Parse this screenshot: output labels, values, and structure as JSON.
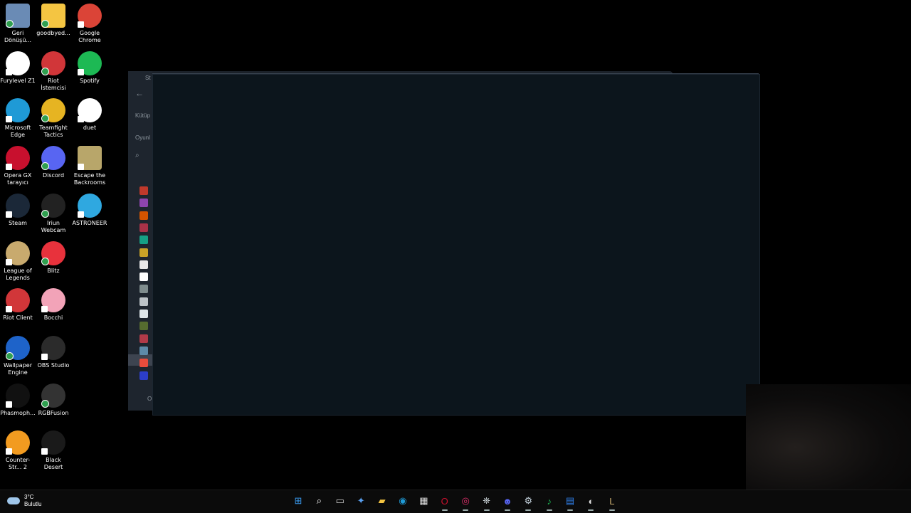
{
  "desktop_icons": [
    {
      "label": "Geri Dönüşü...",
      "icon": "recycle-bin-icon",
      "color": "#6a8bb5"
    },
    {
      "label": "goodbyed...",
      "icon": "folder-icon",
      "color": "#f4c542"
    },
    {
      "label": "Google Chrome",
      "icon": "chrome-icon",
      "color": "#db4437"
    },
    {
      "label": "Furylevel Z1",
      "icon": "furylevel-icon",
      "color": "#ffffff"
    },
    {
      "label": "Riot İstemcisi",
      "icon": "riot-client-icon",
      "color": "#d13639"
    },
    {
      "label": "Spotify",
      "icon": "spotify-icon",
      "color": "#1db954"
    },
    {
      "label": "Microsoft Edge",
      "icon": "edge-icon",
      "color": "#1f9ad6"
    },
    {
      "label": "Teamfight Tactics",
      "icon": "tft-icon",
      "color": "#e6b422"
    },
    {
      "label": "duet",
      "icon": "duet-icon",
      "color": "#ffffff"
    },
    {
      "label": "Opera GX tarayıcı",
      "icon": "opera-gx-icon",
      "color": "#c8102e"
    },
    {
      "label": "Discord",
      "icon": "discord-icon",
      "color": "#5865f2"
    },
    {
      "label": "Escape the Backrooms",
      "icon": "escape-backrooms-icon",
      "color": "#b8a66a"
    },
    {
      "label": "Steam",
      "icon": "steam-icon",
      "color": "#1b2838"
    },
    {
      "label": "Iriun Webcam",
      "icon": "iriun-webcam-icon",
      "color": "#222222"
    },
    {
      "label": "ASTRONEER",
      "icon": "astroneer-icon",
      "color": "#2fa8e0"
    },
    {
      "label": "League of Legends",
      "icon": "league-icon",
      "color": "#c8aa6e"
    },
    {
      "label": "Blitz",
      "icon": "blitz-icon",
      "color": "#e8323c"
    },
    {
      "label": "Riot Client",
      "icon": "riot-client-icon",
      "color": "#d13639"
    },
    {
      "label": "Bocchi",
      "icon": "bocchi-icon",
      "color": "#f2a3b8"
    },
    {
      "label": "Wallpaper Engine",
      "icon": "wallpaper-engine-icon",
      "color": "#1e63c9"
    },
    {
      "label": "OBS Studio",
      "icon": "obs-icon",
      "color": "#2b2b2b"
    },
    {
      "label": "Phasmoph...",
      "icon": "phasmophobia-icon",
      "color": "#111111"
    },
    {
      "label": "RGBFusion",
      "icon": "rgbfusion-icon",
      "color": "#333333"
    },
    {
      "label": "Counter-Str... 2",
      "icon": "counter-strike-icon",
      "color": "#f29b20"
    },
    {
      "label": "Black Desert",
      "icon": "black-desert-icon",
      "color": "#1a1a1a"
    }
  ],
  "steam_window": {
    "title_partial": "St",
    "library_partial": "Kütüp",
    "games_partial": "Oyunl",
    "bottom_partial": "O",
    "game_colors": [
      "#c0392b",
      "#8e44ad",
      "#d35400",
      "#a93248",
      "#16a085",
      "#c9a227",
      "#e8e8e8",
      "#ffffff",
      "#7f8c8d",
      "#bdc3c7",
      "#dfe6e9",
      "#556b2f",
      "#b03a48",
      "#5d8aa8",
      "#e74c3c",
      "#2c3ec9"
    ]
  },
  "taskbar": {
    "weather": {
      "temp": "3°C",
      "condition": "Bulutlu"
    },
    "apps": [
      {
        "icon": "windows-start-icon",
        "glyph": "⊞",
        "color": "#3a9bf0"
      },
      {
        "icon": "search-icon",
        "glyph": "⌕",
        "color": "#ffffff"
      },
      {
        "icon": "task-view-icon",
        "glyph": "▭",
        "color": "#cccccc"
      },
      {
        "icon": "copilot-icon",
        "glyph": "✦",
        "color": "#5aa0f0"
      },
      {
        "icon": "file-explorer-icon",
        "glyph": "▰",
        "color": "#f4c542"
      },
      {
        "icon": "edge-icon",
        "glyph": "◉",
        "color": "#1f9ad6"
      },
      {
        "icon": "microsoft-store-icon",
        "glyph": "▦",
        "color": "#dddddd"
      },
      {
        "icon": "opera-gx-icon",
        "glyph": "O",
        "color": "#c8102e"
      },
      {
        "icon": "instagram-icon",
        "glyph": "◎",
        "color": "#e1306c"
      },
      {
        "icon": "network-tool-icon",
        "glyph": "⛯",
        "color": "#cfd8dc"
      },
      {
        "icon": "discord-icon",
        "glyph": "☻",
        "color": "#5865f2"
      },
      {
        "icon": "steam-icon",
        "glyph": "⚙",
        "color": "#c7d5e0"
      },
      {
        "icon": "spotify-icon",
        "glyph": "♪",
        "color": "#1db954"
      },
      {
        "icon": "wallpaper-engine-icon",
        "glyph": "▤",
        "color": "#2f80ed"
      },
      {
        "icon": "github-icon",
        "glyph": "◐",
        "color": "#dddddd"
      },
      {
        "icon": "league-icon",
        "glyph": "L",
        "color": "#c8aa6e"
      }
    ]
  }
}
